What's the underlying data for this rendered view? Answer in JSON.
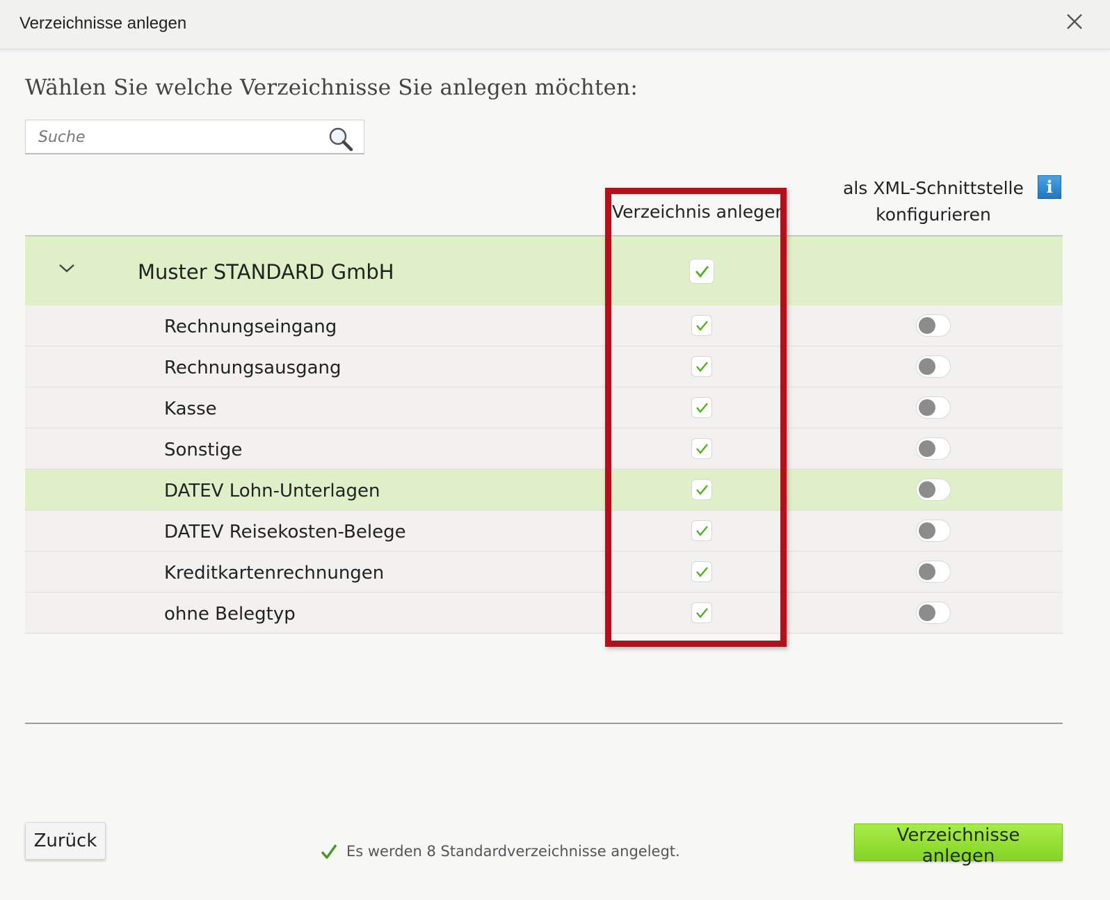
{
  "dialog": {
    "title": "Verzeichnisse anlegen",
    "heading": "Wählen Sie welche Verzeichnisse Sie anlegen möchten:"
  },
  "search": {
    "placeholder": "Suche",
    "value": ""
  },
  "columns": {
    "create": "Verzeichnis anlegen",
    "xml_line1": "als XML-Schnittstelle",
    "xml_line2": "konfigurieren",
    "info_icon": "i"
  },
  "group": {
    "name": "Muster STANDARD GmbH",
    "expanded": true,
    "checked": true
  },
  "rows": [
    {
      "label": "Rechnungseingang",
      "checked": true,
      "xml": false
    },
    {
      "label": "Rechnungsausgang",
      "checked": true,
      "xml": false
    },
    {
      "label": "Kasse",
      "checked": true,
      "xml": false
    },
    {
      "label": "Sonstige",
      "checked": true,
      "xml": false
    },
    {
      "label": "DATEV Lohn-Unterlagen",
      "checked": true,
      "xml": false,
      "highlighted": true
    },
    {
      "label": "DATEV Reisekosten-Belege",
      "checked": true,
      "xml": false
    },
    {
      "label": "Kreditkartenrechnungen",
      "checked": true,
      "xml": false
    },
    {
      "label": "ohne Belegtyp",
      "checked": true,
      "xml": false
    }
  ],
  "footer": {
    "back_label": "Zurück",
    "status": "Es werden 8 Standardverzeichnisse angelegt.",
    "create_label": "Verzeichnisse anlegen"
  },
  "colors": {
    "accent_green": "#86d424",
    "row_highlight": "#dff0c8",
    "annotation_red": "#b0111b",
    "info_blue": "#1f78c1"
  },
  "icons": [
    "close-icon",
    "search-icon",
    "info-icon",
    "chevron-down-icon",
    "checkmark-icon"
  ]
}
